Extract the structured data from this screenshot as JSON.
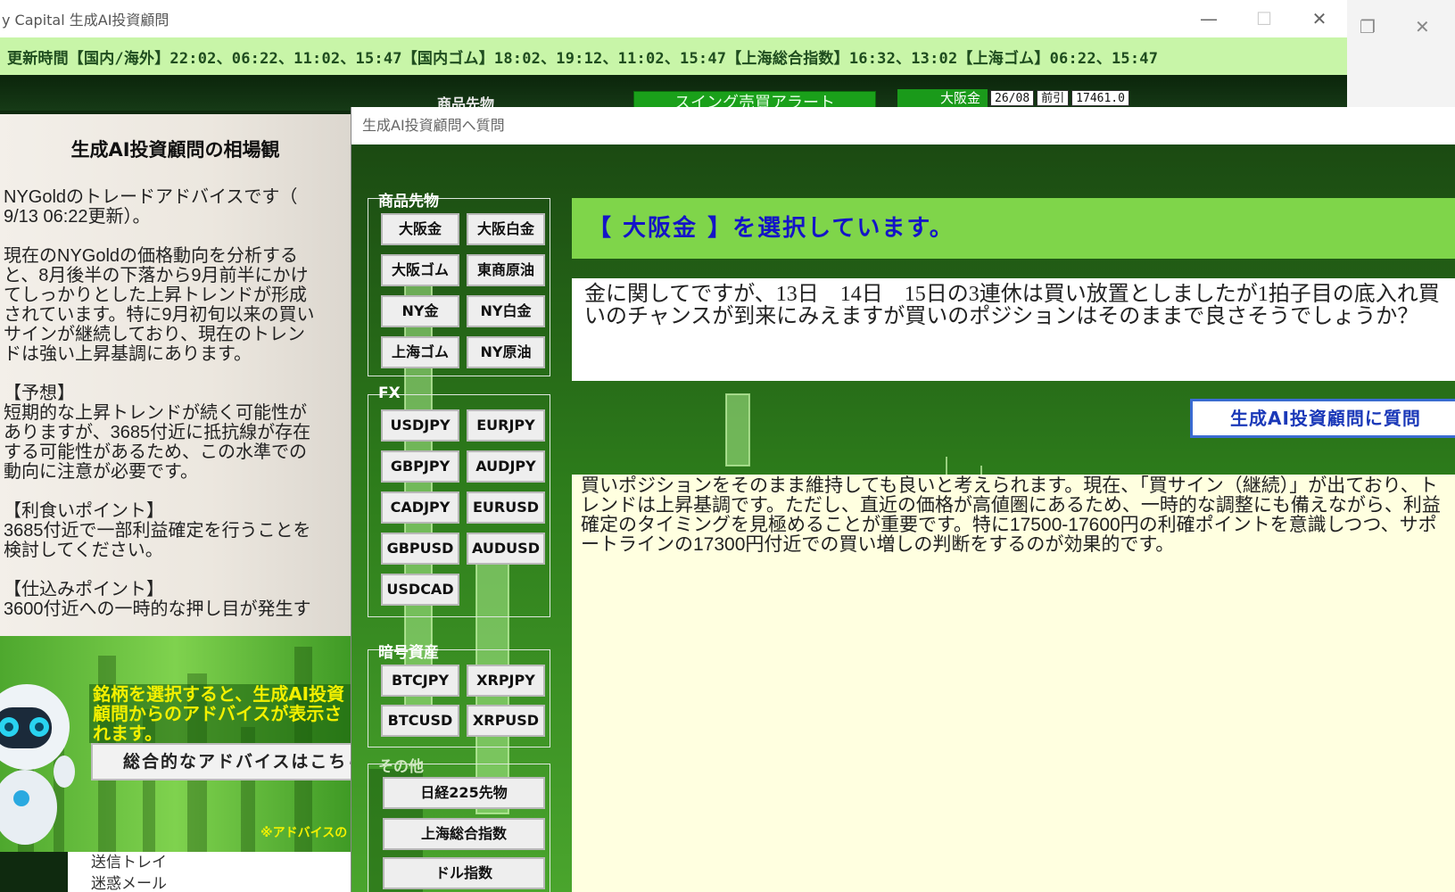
{
  "window": {
    "title": "y Capital 生成AI投資顧問",
    "controls": [
      "—",
      "☐",
      "✕"
    ]
  },
  "update_bar": {
    "text": "更新時間【国内/海外】22:02、06:22、11:02、15:47【国内ゴム】18:02、19:12、11:02、15:47【上海総合指数】16:32、13:02【上海ゴム】06:22、15:47"
  },
  "strip": {
    "label": "商品先物",
    "swing_button": "スイング売買アラート",
    "quote": {
      "name": "大阪金",
      "date": "26/08",
      "type": "前引",
      "price": "17461.0"
    }
  },
  "left_panel": {
    "title": "生成AI投資顧問の相場観",
    "body": "NYGoldのトレードアドバイスです（\n9/13 06:22更新）。\n\n現在のNYGoldの価格動向を分析する\nと、8月後半の下落から9月前半にかけ\nてしっかりとした上昇トレンドが形成\nされています。特に9月初旬以来の買い\nサインが継続しており、現在のトレン\nドは強い上昇基調にあります。\n\n【予想】\n短期的な上昇トレンドが続く可能性が\nありますが、3685付近に抵抗線が存在\nする可能性があるため、この水準での\n動向に注意が必要です。\n\n【利食いポイント】\n3685付近で一部利益確定を行うことを\n検討してください。\n\n【仕込みポイント】\n3600付近への一時的な押し目が発生す",
    "yellow_message": "銘柄を選択すると、生成AI投資顧問からのアドバイスが表示されます。",
    "overall_button": "総合的なアドバイスはこちら",
    "note": "※アドバイスの"
  },
  "behind_window": {
    "items": [
      "送信トレイ",
      "迷惑メール"
    ]
  },
  "dialog": {
    "title": "生成AI投資顧問へ質問",
    "groups": {
      "commodity": {
        "label": "商品先物",
        "buttons": [
          "大阪金",
          "大阪白金",
          "大阪ゴム",
          "東商原油",
          "NY金",
          "NY白金",
          "上海ゴム",
          "NY原油"
        ]
      },
      "fx": {
        "label": "FX",
        "buttons": [
          "USDJPY",
          "EURJPY",
          "GBPJPY",
          "AUDJPY",
          "CADJPY",
          "EURUSD",
          "GBPUSD",
          "AUDUSD",
          "USDCAD"
        ]
      },
      "crypto": {
        "label": "暗号資産",
        "buttons": [
          "BTCJPY",
          "XRPJPY",
          "BTCUSD",
          "XRPUSD"
        ]
      },
      "other": {
        "label": "その他",
        "buttons": [
          "日経225先物",
          "上海総合指数",
          "ドル指数"
        ]
      }
    },
    "selection_banner": "【 大阪金 】を選択しています。",
    "question": "金に関してですが、13日　14日　15日の3連休は買い放置としましたが1拍子目の底入れ買いのチャンスが到来にみえますが買いのポジションはそのままで良さそうでしょうか？",
    "ask_button": "生成AI投資顧問に質問",
    "answer": "買いポジションをそのまま維持しても良いと考えられます。現在、「買サイン（継続）」が出ており、トレンドは上昇基調です。ただし、直近の価格が高値圏にあるため、一時的な調整にも備えながら、利益確定のタイミングを見極めることが重要です。特に17500-17600円の利確ポイントを意識しつつ、サポートラインの17300円付近での買い増しの判断をするのが効果的です。"
  },
  "colors": {
    "update_bar_bg": "#c8f5a8",
    "banner_bg": "#7fd54a",
    "banner_text": "#1414c8",
    "answer_bg": "#ffffe0",
    "yellow_text": "#f3f000"
  }
}
